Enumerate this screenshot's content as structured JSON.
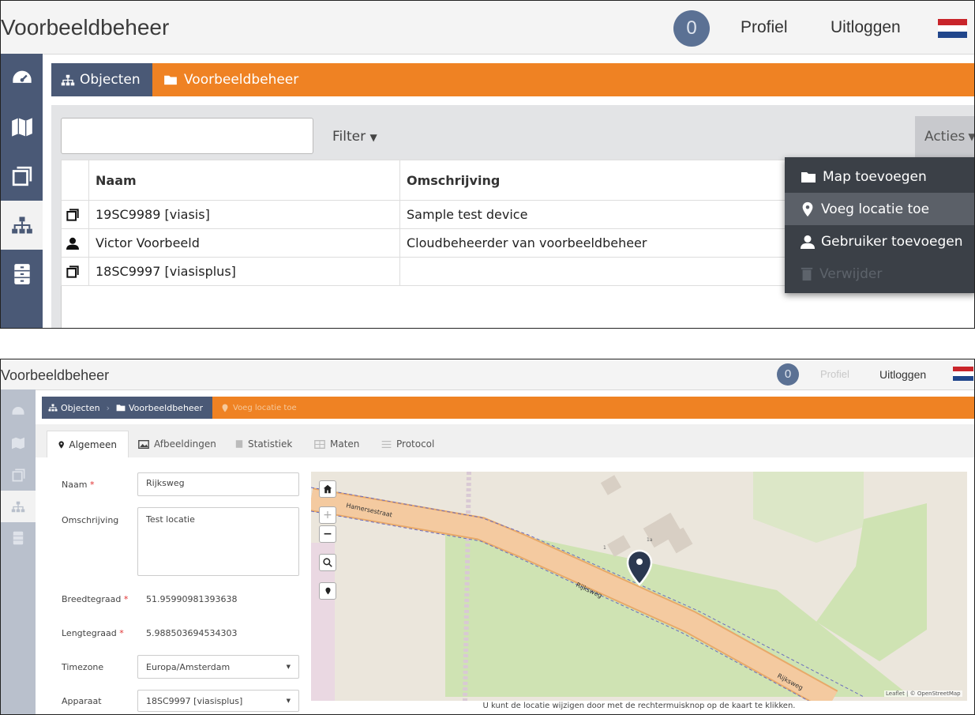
{
  "top": {
    "app_title": "Voorbeeldbeheer",
    "notifications": "0",
    "profile_label": "Profiel",
    "logout_label": "Uitloggen"
  },
  "nav_icons": [
    "dashboard-icon",
    "map-icon",
    "devices-icon",
    "hierarchy-icon",
    "storage-icon"
  ],
  "breadcrumb": {
    "root": "Objecten",
    "folder": "Voorbeeldbeheer",
    "current": "Voeg locatie toe"
  },
  "list": {
    "filter_label": "Filter",
    "search_placeholder": "",
    "actions_label": "Acties",
    "columns": [
      "Naam",
      "Omschrijving"
    ],
    "rows": [
      {
        "icon": "device-icon",
        "name": "19SC9989 [viasis]",
        "description": "Sample test device"
      },
      {
        "icon": "user-icon",
        "name": "Victor Voorbeeld",
        "description": "Cloudbeheerder van voorbeeldbeheer"
      },
      {
        "icon": "device-icon",
        "name": "18SC9997 [viasisplus]",
        "description": ""
      }
    ]
  },
  "actions_menu": {
    "items": [
      {
        "icon": "folder-icon",
        "label": "Map toevoegen",
        "state": "normal"
      },
      {
        "icon": "map-marker-icon",
        "label": "Voeg locatie toe",
        "state": "highlighted"
      },
      {
        "icon": "user-icon",
        "label": "Gebruiker toevoegen",
        "state": "normal"
      },
      {
        "icon": "trash-icon",
        "label": "Verwijder",
        "state": "disabled"
      }
    ]
  },
  "tabs": [
    {
      "icon": "map-marker-icon",
      "label": "Algemeen",
      "active": true
    },
    {
      "icon": "image-icon",
      "label": "Afbeeldingen",
      "active": false
    },
    {
      "icon": "statistics-icon",
      "label": "Statistiek",
      "active": false
    },
    {
      "icon": "measurements-icon",
      "label": "Maten",
      "active": false
    },
    {
      "icon": "protocol-icon",
      "label": "Protocol",
      "active": false
    }
  ],
  "form": {
    "name_label": "Naam",
    "name_value": "Rijksweg",
    "description_label": "Omschrijving",
    "description_value": "Test locatie",
    "latitude_label": "Breedtegraad",
    "latitude_value": "51.95990981393638",
    "longitude_label": "Lengtegraad",
    "longitude_value": "5.988503694534303",
    "timezone_label": "Timezone",
    "timezone_value": "Europa/Amsterdam",
    "device_label": "Apparaat",
    "device_value": "18SC9997 [viasisplus]",
    "required_mark": "*"
  },
  "map": {
    "street_top": "Hamersestraat",
    "street_main": "Rijksweg",
    "street_main_2": "Rijksweg",
    "house_numbers": [
      "1",
      "1a"
    ],
    "zoom_in": "+",
    "zoom_out": "−",
    "attribution": "Leaflet | © OpenStreetMap",
    "hint": "U kunt de locatie wijzigen door met de rechtermuisknop op de kaart te klikken."
  }
}
